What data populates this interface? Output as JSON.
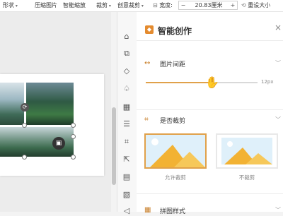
{
  "toolbar": {
    "shape_label": "形状",
    "compress_label": "压缩图片",
    "smart_zoom_label": "智能缩放",
    "crop_label": "裁剪",
    "creative_crop_label": "创意裁剪",
    "width_label": "宽度:",
    "width_value": "20.83厘米",
    "minus_label": "−",
    "plus_label": "+",
    "reset_size_label": "重设大小"
  },
  "panel": {
    "title": "智能创作",
    "logo_text": "◆",
    "close_icon": "×",
    "sections": {
      "spacing": {
        "title": "图片间距",
        "value": "12px",
        "slider_fraction": 0.6
      },
      "crop": {
        "title": "是否裁剪",
        "options": [
          {
            "label": "允许裁剪",
            "selected": true
          },
          {
            "label": "不裁剪",
            "selected": false
          }
        ]
      },
      "layout_style": {
        "title": "拼图样式"
      }
    }
  },
  "colors": {
    "accent": "#e0a14a",
    "logo": "#e48b2f"
  }
}
